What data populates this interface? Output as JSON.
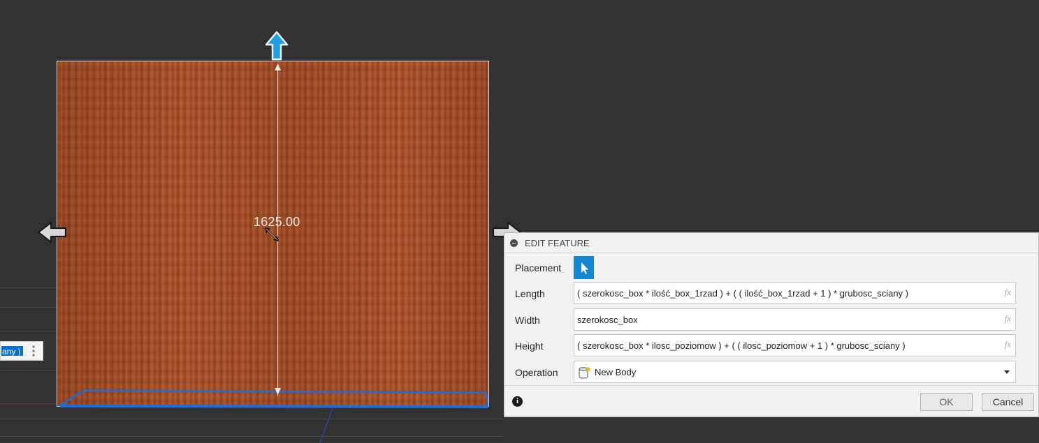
{
  "viewport": {
    "dimension_value": "1625.00",
    "mini_input_value": "any )"
  },
  "dialog": {
    "title": "EDIT FEATURE",
    "fields": {
      "placement_label": "Placement",
      "length_label": "Length",
      "length_value": "( szerokosc_box * ilość_box_1rzad ) + ( ( ilość_box_1rzad + 1 ) * grubosc_sciany )",
      "width_label": "Width",
      "width_value": "szerokosc_box",
      "height_label": "Height",
      "height_value": "( szerokosc_box * ilosc_poziomow ) + ( ( ilosc_poziomow + 1 ) * grubosc_sciany )",
      "operation_label": "Operation",
      "operation_value": "New Body",
      "fx_label": "fx"
    },
    "info_glyph": "i",
    "ok_label": "OK",
    "cancel_label": "Cancel"
  },
  "colors": {
    "background": "#323232",
    "accent": "#1487d4",
    "selection_edge": "#1a6fe0"
  }
}
